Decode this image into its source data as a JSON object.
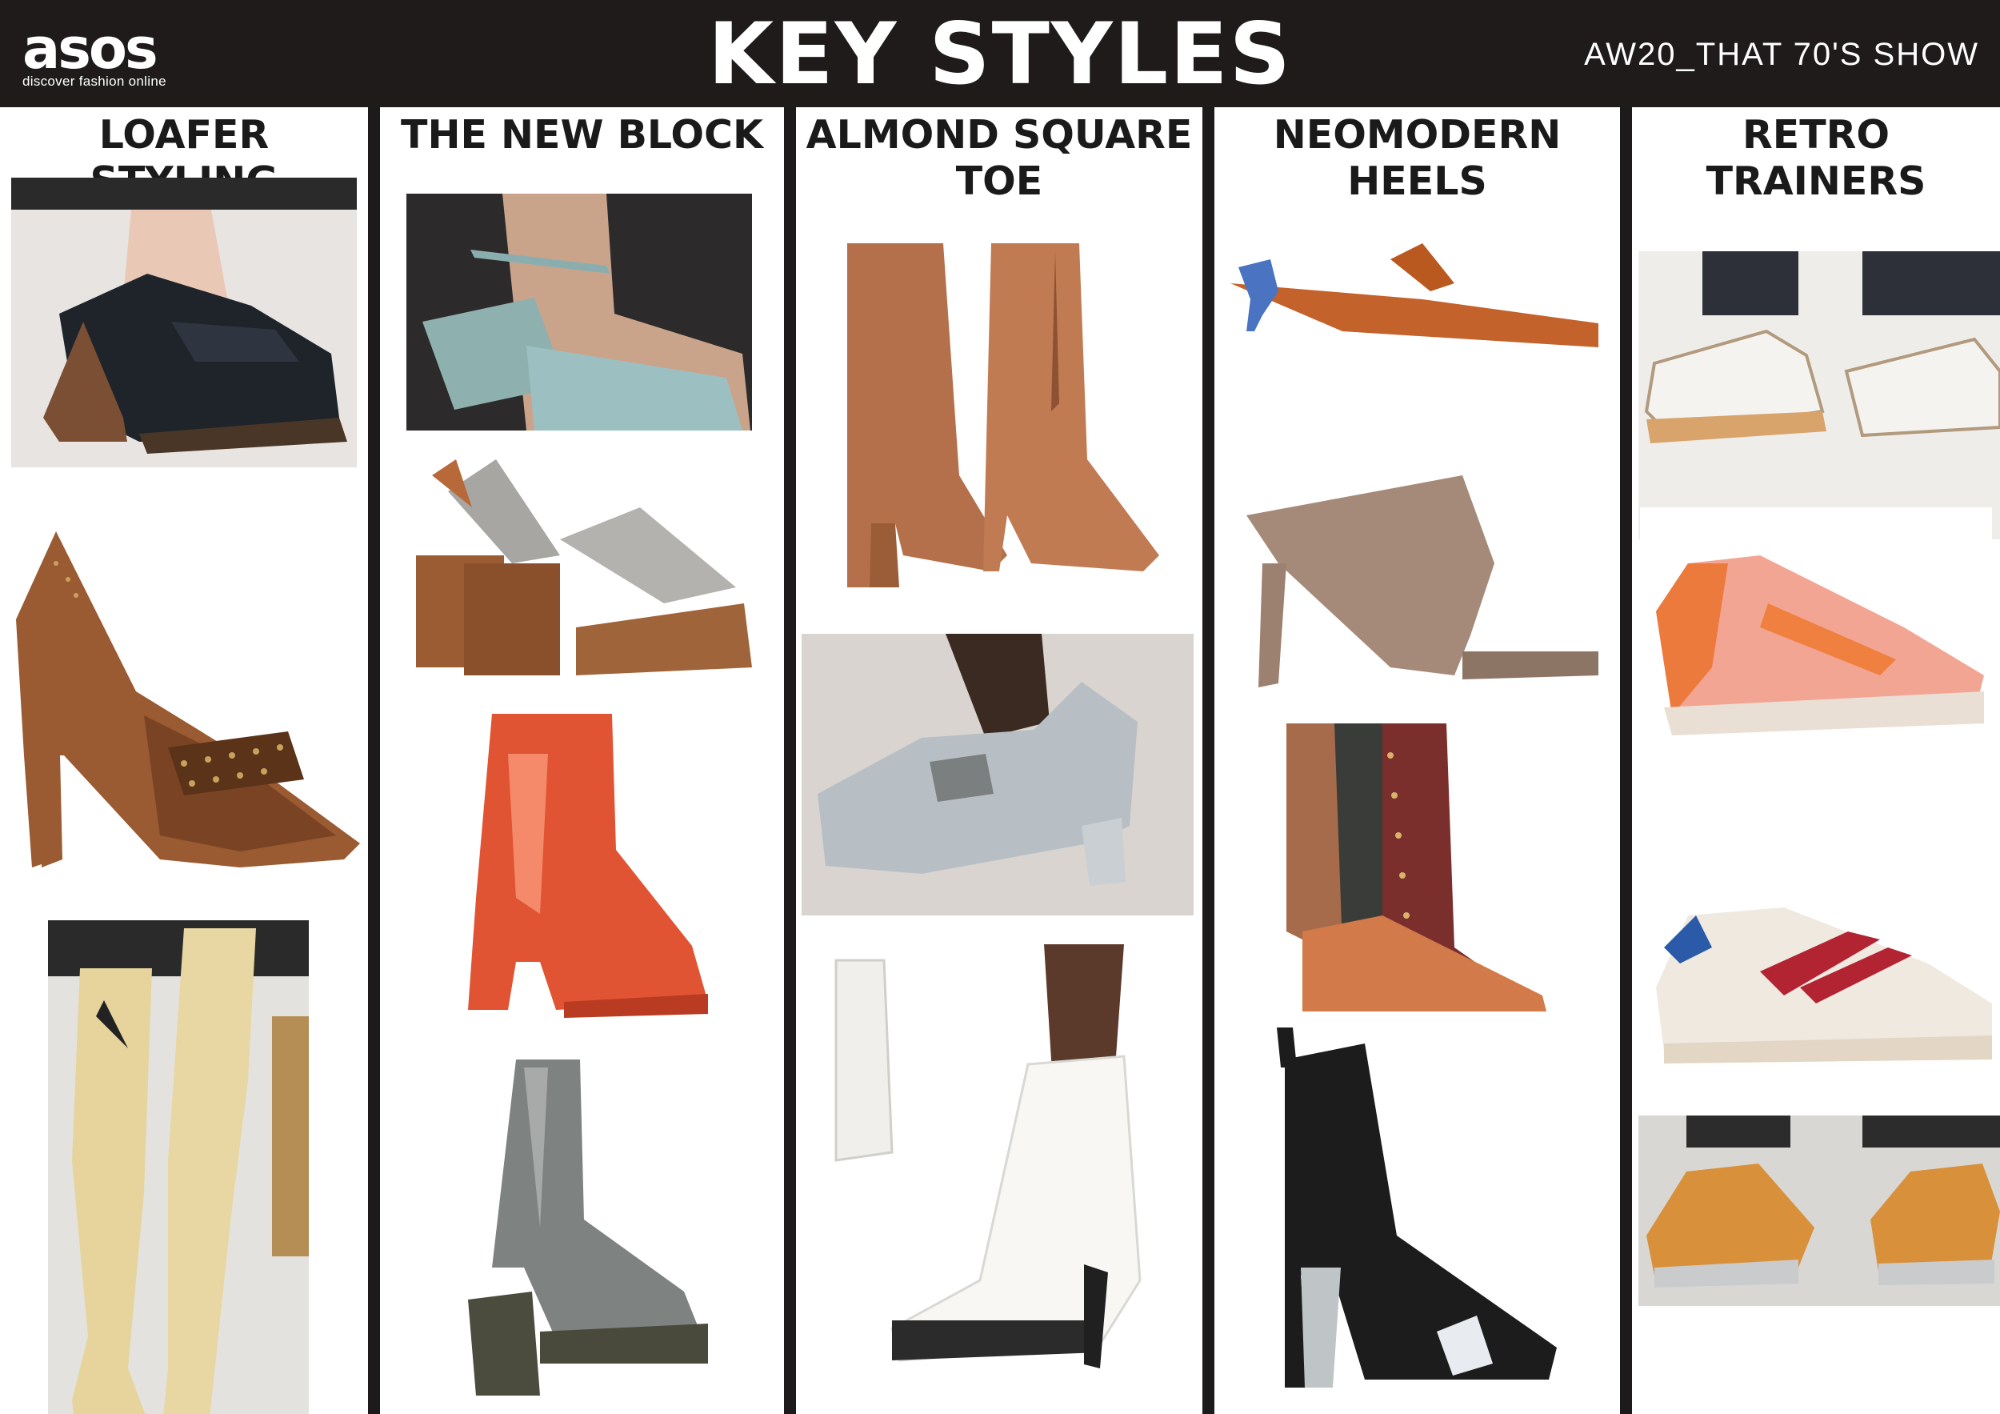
{
  "header": {
    "brand": "asos",
    "tagline": "discover fashion online",
    "title": "KEY STYLES",
    "season": "AW20_THAT 70'S SHOW"
  },
  "columns": [
    {
      "title_lines": [
        "LOAFER STYLING"
      ]
    },
    {
      "title_lines": [
        "THE NEW BLOCK"
      ]
    },
    {
      "title_lines": [
        "ALMOND SQUARE",
        "TOE"
      ]
    },
    {
      "title_lines": [
        "NEOMODERN",
        "HEELS"
      ]
    },
    {
      "title_lines": [
        "RETRO TRAINERS"
      ]
    }
  ],
  "colors": {
    "header_bg": "#1f1b1b",
    "panel_bg": "#ffffff",
    "title_text": "#1a1a1a"
  }
}
